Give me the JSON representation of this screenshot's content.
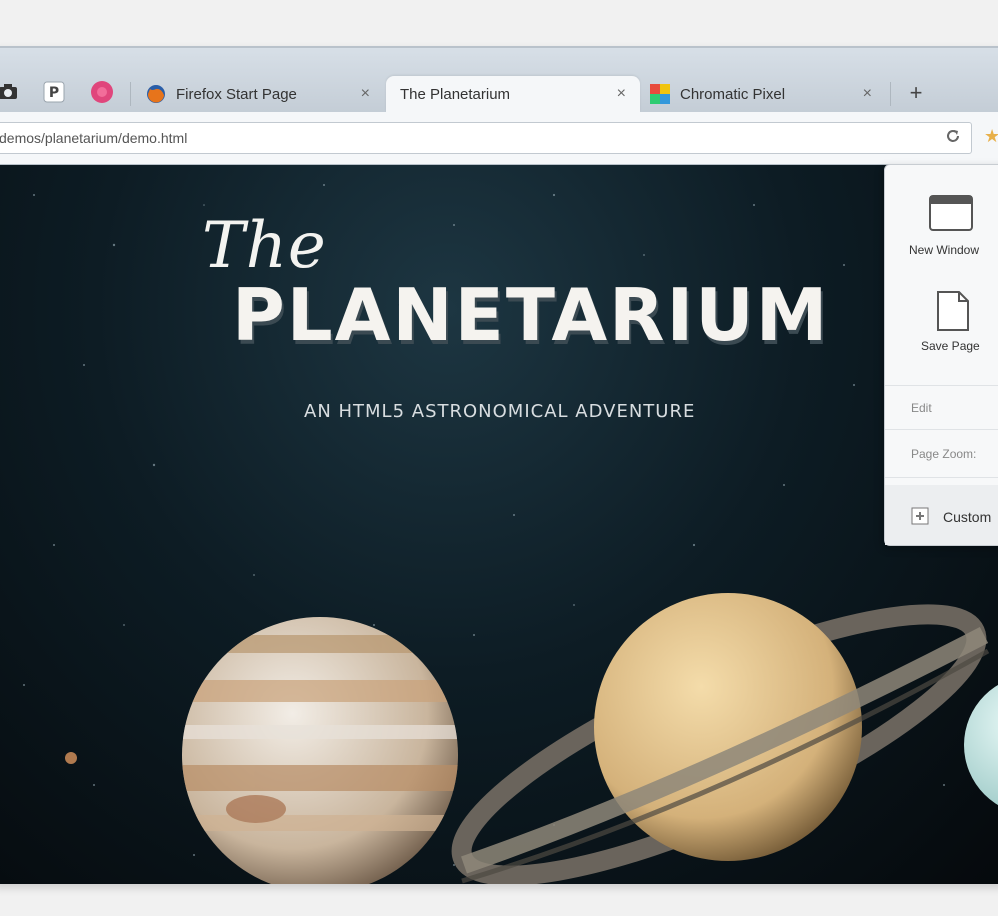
{
  "tabs": [
    {
      "title": "Firefox Start Page",
      "close": "×"
    },
    {
      "title": "The Planetarium",
      "close": "×",
      "active": true
    },
    {
      "title": "Chromatic Pixel",
      "close": "×"
    }
  ],
  "pinned_tabs": [
    {
      "icon": "camera-icon",
      "glyph": "📷"
    },
    {
      "icon": "p-logo-icon",
      "glyph": "P"
    },
    {
      "icon": "flickr-icon",
      "glyph": "●"
    }
  ],
  "new_tab_label": "+",
  "url": "demos/planetarium/demo.html",
  "page": {
    "title_script": "The",
    "title_main": "Planetarium",
    "subtitle": "An HTML5 Astronomical Adventure"
  },
  "menu": {
    "new_window": "New Window",
    "save_page": "Save Page",
    "edit": "Edit",
    "page_zoom": "Page Zoom:",
    "customize": "Custom"
  },
  "colors": {
    "accent": "#e8b04a",
    "sky": "#0d1c24"
  }
}
